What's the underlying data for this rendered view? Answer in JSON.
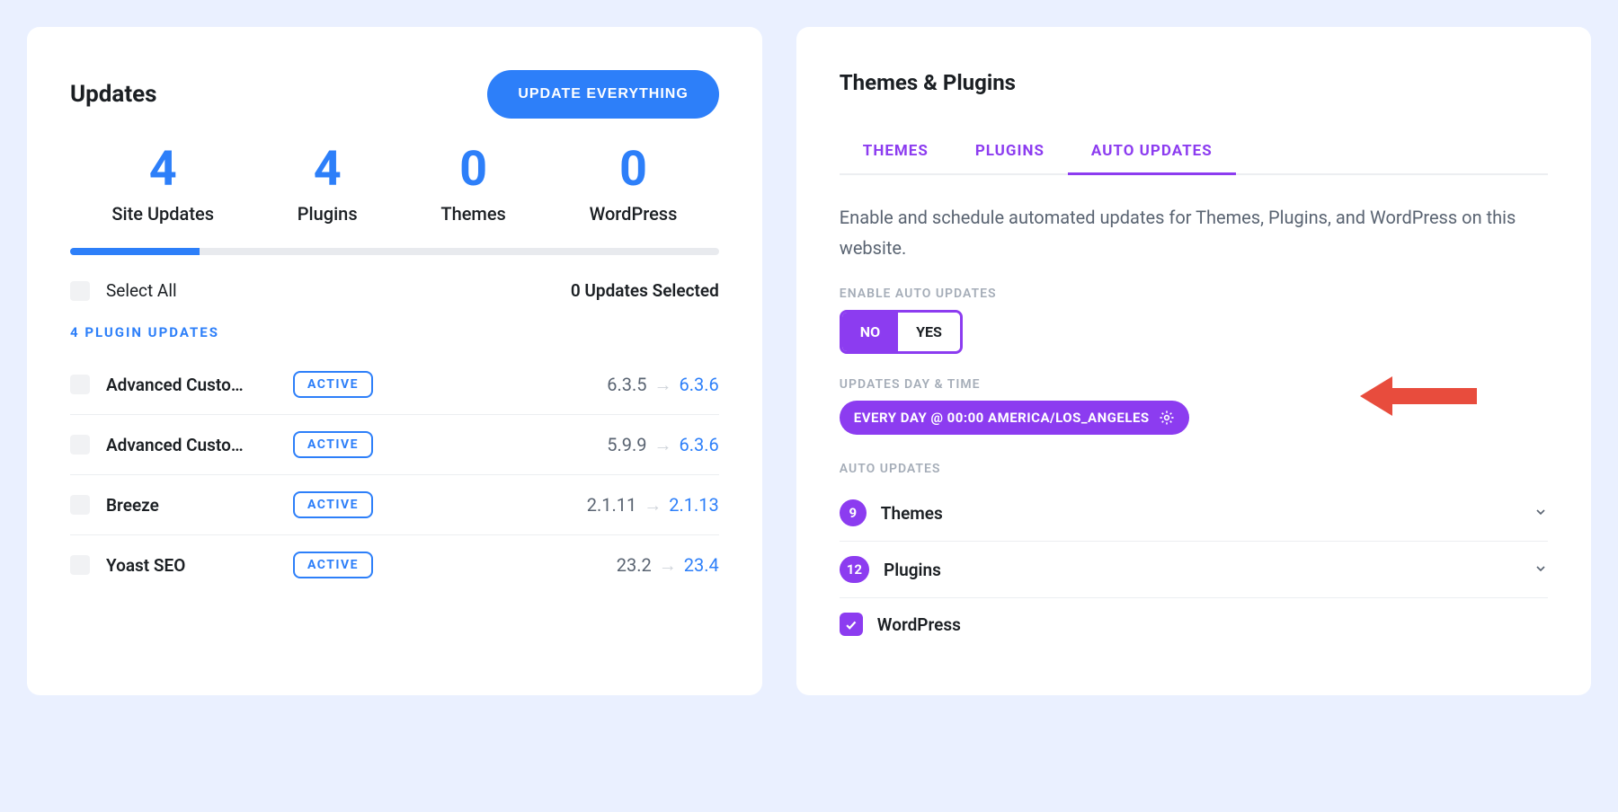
{
  "updates": {
    "title": "Updates",
    "update_all_label": "UPDATE EVERYTHING",
    "stats": [
      {
        "value": "4",
        "label": "Site Updates"
      },
      {
        "value": "4",
        "label": "Plugins"
      },
      {
        "value": "0",
        "label": "Themes"
      },
      {
        "value": "0",
        "label": "WordPress"
      }
    ],
    "progress_percent": 20,
    "select_all_label": "Select All",
    "selected_text": "0 Updates Selected",
    "plugin_section_label": "4 PLUGIN UPDATES",
    "active_badge": "ACTIVE",
    "plugins": [
      {
        "name": "Advanced Custo…",
        "old": "6.3.5",
        "new": "6.3.6"
      },
      {
        "name": "Advanced Custo…",
        "old": "5.9.9",
        "new": "6.3.6"
      },
      {
        "name": "Breeze",
        "old": "2.1.11",
        "new": "2.1.13"
      },
      {
        "name": "Yoast SEO",
        "old": "23.2",
        "new": "23.4"
      }
    ]
  },
  "themes_plugins": {
    "title": "Themes & Plugins",
    "tabs": {
      "themes": "THEMES",
      "plugins": "PLUGINS",
      "auto": "AUTO UPDATES"
    },
    "active_tab": "auto",
    "description": "Enable and schedule automated updates for Themes, Plugins, and WordPress on this website.",
    "enable_label": "ENABLE AUTO UPDATES",
    "toggle": {
      "no": "NO",
      "yes": "YES",
      "value": "YES"
    },
    "schedule_label": "UPDATES DAY & TIME",
    "schedule_text": "EVERY DAY  @ 00:00  AMERICA/LOS_ANGELES",
    "auto_section_label": "AUTO UPDATES",
    "rows": [
      {
        "count": "9",
        "label": "Themes",
        "expandable": true
      },
      {
        "count": "12",
        "label": "Plugins",
        "expandable": true
      },
      {
        "checked": true,
        "label": "WordPress",
        "expandable": false
      }
    ]
  }
}
